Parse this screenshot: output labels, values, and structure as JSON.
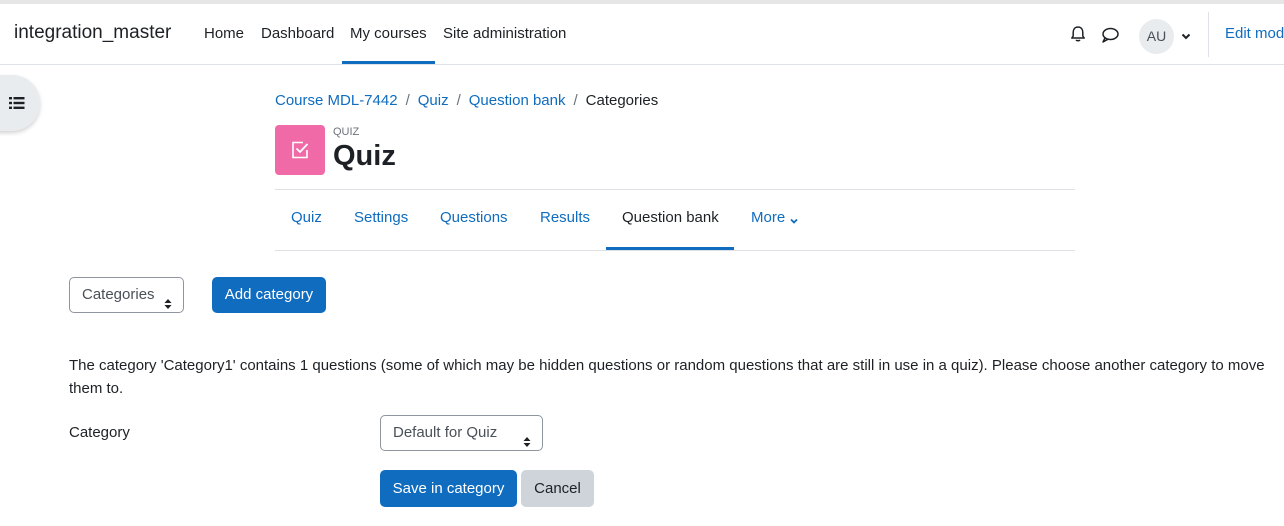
{
  "navbar": {
    "site_name": "integration_master",
    "links": [
      "Home",
      "Dashboard",
      "My courses",
      "Site administration"
    ],
    "active_link": "My courses",
    "avatar_initials": "AU",
    "edit_mode_label": "Edit mode",
    "icons": [
      "bell-icon",
      "chat-icon",
      "chevron-down-icon"
    ]
  },
  "drawer": {
    "icon": "list-icon"
  },
  "breadcrumb": [
    "Course MDL-7442",
    "Quiz",
    "Question bank",
    "Categories"
  ],
  "header": {
    "module_type": "QUIZ",
    "title": "Quiz",
    "icon": "quiz-check-icon",
    "icon_color": "#f06aa8"
  },
  "tabs": {
    "items": [
      "Quiz",
      "Settings",
      "Questions",
      "Results",
      "Question bank",
      "More"
    ],
    "active": "Question bank"
  },
  "toolbar": {
    "select_value": "Categories",
    "add_button": "Add category"
  },
  "message": "The category 'Category1' contains 1 questions (some of which may be hidden questions or random questions that are still in use in a quiz). Please choose another category to move them to.",
  "form": {
    "category_label": "Category",
    "category_value": "Default for Quiz",
    "save_button": "Save in category",
    "cancel_button": "Cancel"
  },
  "colors": {
    "primary": "#0f6cbf",
    "text": "#1d2125",
    "secondary_button": "#ced4da"
  }
}
